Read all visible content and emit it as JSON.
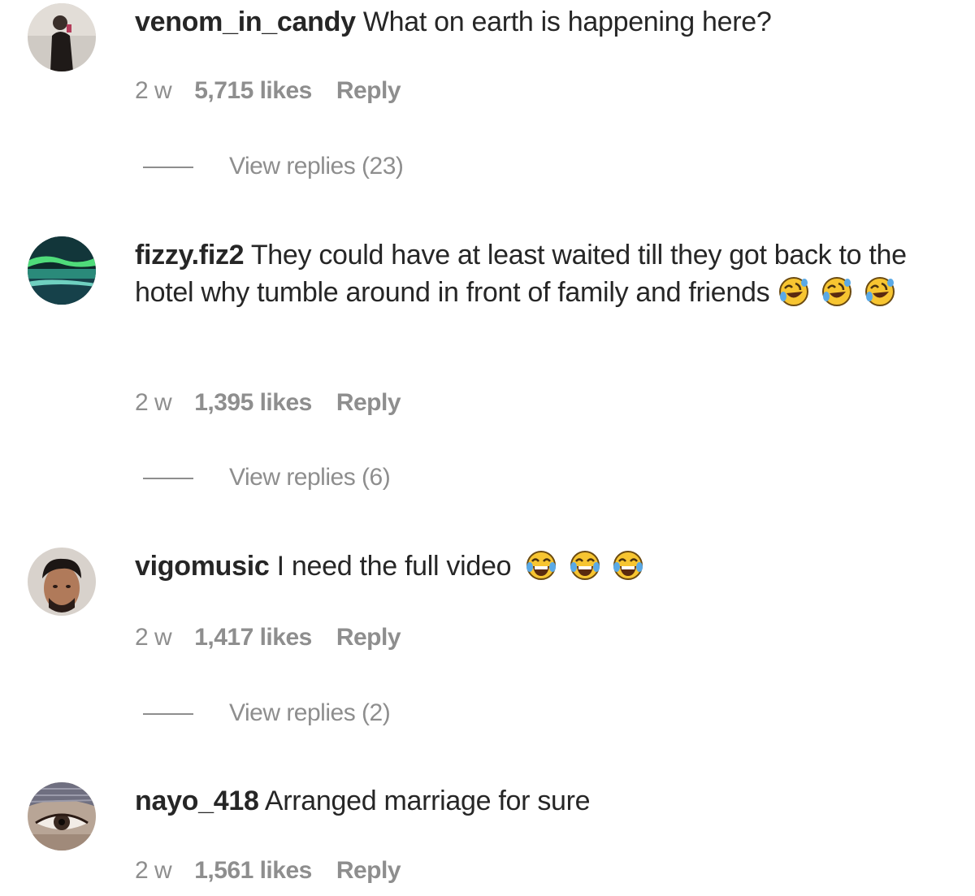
{
  "comments": [
    {
      "username": "venom_in_candy",
      "text": "What on earth is happening here?",
      "emoji_count": 0,
      "time": "2 w",
      "likes": "5,715 likes",
      "reply": "Reply",
      "view_replies": "View replies (23)",
      "avatar_icon": "person-dark-outfit-avatar"
    },
    {
      "username": "fizzy.fiz2",
      "text": "They could have at least waited till they got back to the hotel why tumble around in front of family and friends",
      "emoji": "rolling-on-floor-laughing-emoji",
      "emoji_count": 3,
      "time": "2 w",
      "likes": "1,395 likes",
      "reply": "Reply",
      "view_replies": "View replies (6)",
      "avatar_icon": "aurora-landscape-avatar"
    },
    {
      "username": "vigomusic",
      "text": "I need the full video",
      "emoji": "tears-of-joy-emoji",
      "emoji_count": 3,
      "time": "2 w",
      "likes": "1,417 likes",
      "reply": "Reply",
      "view_replies": "View replies (2)",
      "avatar_icon": "man-portrait-avatar"
    },
    {
      "username": "nayo_418",
      "text": "Arranged marriage for sure",
      "emoji_count": 0,
      "time": "2 w",
      "likes": "1,561 likes",
      "reply": "Reply",
      "avatar_icon": "eye-closeup-avatar"
    }
  ],
  "colors": {
    "text": "#262626",
    "secondary": "#8e8e8e",
    "emoji_face": "#f7c531",
    "emoji_tears": "#5aa9e6"
  }
}
